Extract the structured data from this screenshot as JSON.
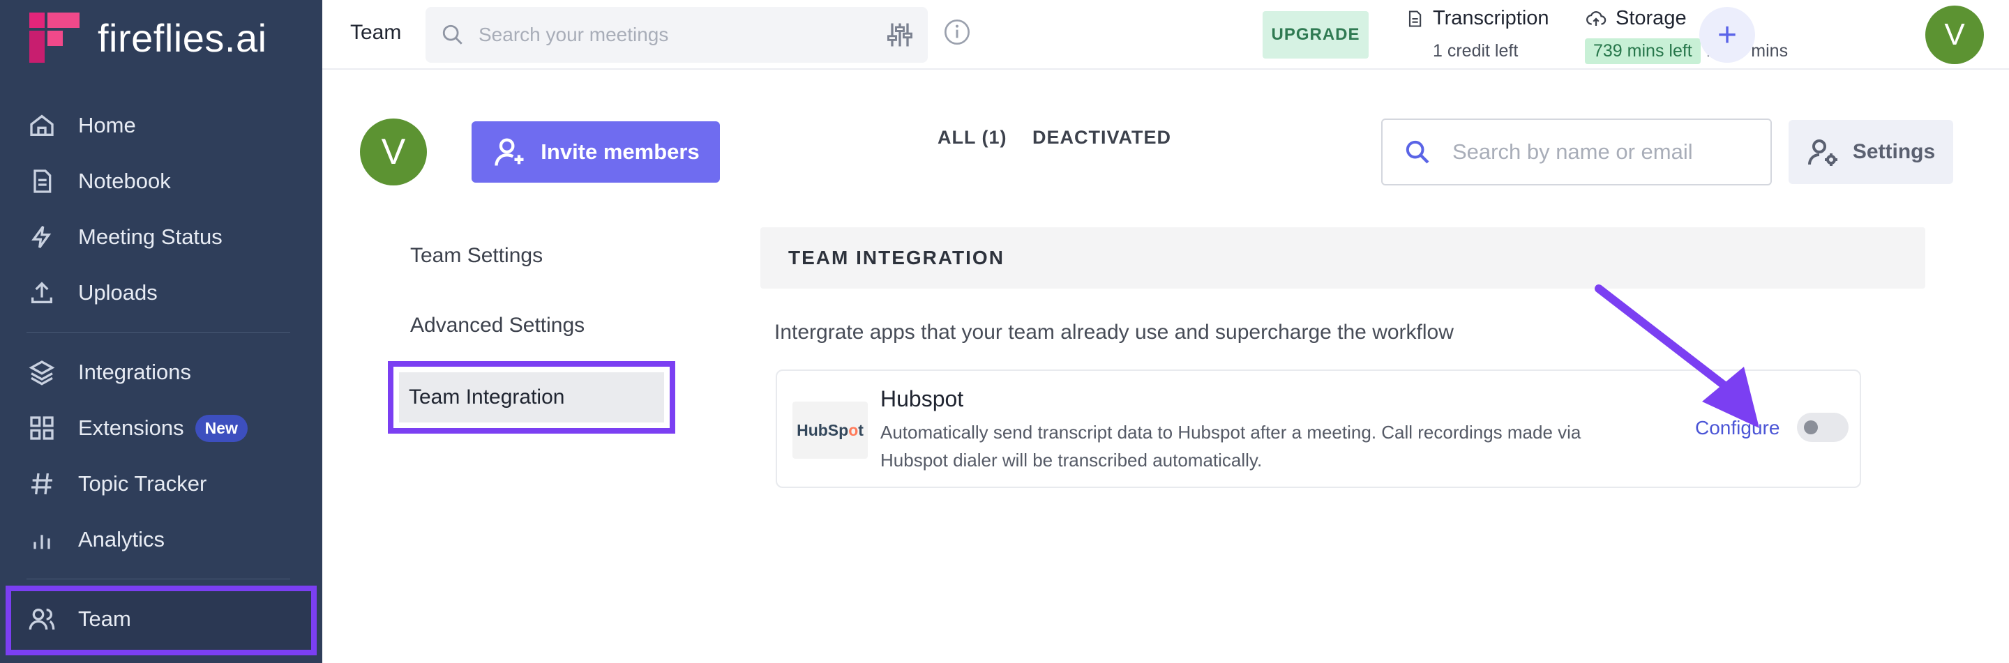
{
  "app": {
    "name": "fireflies.ai"
  },
  "sidebar": {
    "items": [
      {
        "label": "Home",
        "icon": "home-icon"
      },
      {
        "label": "Notebook",
        "icon": "notebook-icon"
      },
      {
        "label": "Meeting Status",
        "icon": "lightning-icon"
      },
      {
        "label": "Uploads",
        "icon": "upload-icon"
      },
      {
        "label": "Integrations",
        "icon": "layers-icon"
      },
      {
        "label": "Extensions",
        "icon": "grid-icon",
        "badge": "New"
      },
      {
        "label": "Topic Tracker",
        "icon": "hash-icon"
      },
      {
        "label": "Analytics",
        "icon": "bar-chart-icon"
      },
      {
        "label": "Team",
        "icon": "users-icon",
        "active": true
      }
    ]
  },
  "topbar": {
    "title": "Team",
    "search_placeholder": "Search your meetings",
    "upgrade_label": "UPGRADE",
    "transcription": {
      "label": "Transcription",
      "credits": "1 credit left"
    },
    "storage": {
      "label": "Storage",
      "left": "739 mins left",
      "total": "/ 800 mins"
    },
    "avatar_initial": "V"
  },
  "team": {
    "avatar_initial": "V",
    "invite_label": "Invite members",
    "tabs": [
      "ALL (1)",
      "DEACTIVATED"
    ],
    "search_placeholder": "Search by name or email",
    "settings_label": "Settings"
  },
  "settings_menu": {
    "items": [
      "Team Settings",
      "Advanced Settings",
      "Team Integration"
    ],
    "active": "Team Integration"
  },
  "integration": {
    "header": "TEAM INTEGRATION",
    "subtitle": "Intergrate apps that your team already use and supercharge the workflow",
    "card": {
      "logo_text_a": "HubSp",
      "logo_text_b": "o",
      "logo_text_c": "t",
      "title": "Hubspot",
      "description": "Automatically send transcript data to Hubspot after a meeting. Call recordings made via Hubspot dialer will be transcribed automatically.",
      "configure_label": "Configure",
      "enabled": false
    }
  },
  "colors": {
    "sidebar_bg": "#2f3e5a",
    "accent_purple": "#7b3ff2",
    "invite_bg": "#6f6cf0",
    "avatar_green": "#5c9332",
    "upgrade_bg": "#d6f2e3"
  }
}
